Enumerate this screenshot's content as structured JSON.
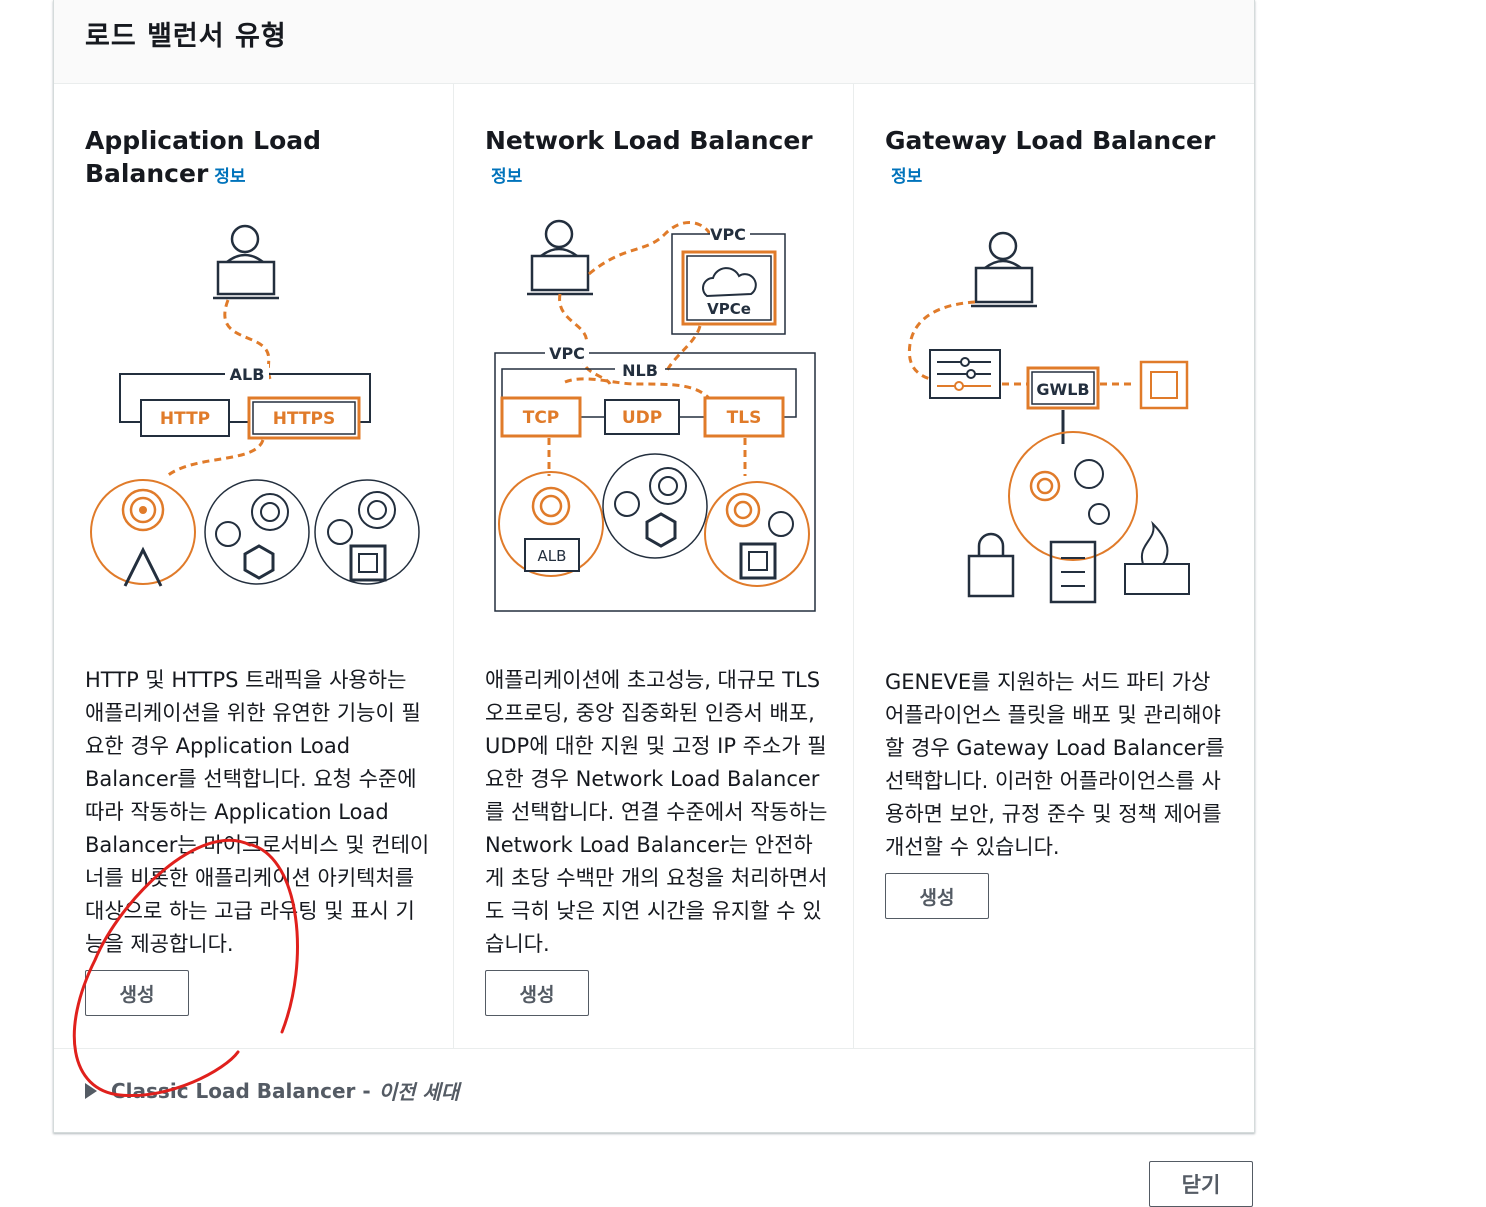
{
  "panel": {
    "title": "로드 밸런서 유형"
  },
  "cards": [
    {
      "title": "Application Load Balancer",
      "info": "정보",
      "diagram": {
        "group_label": "ALB",
        "listeners": [
          "HTTP",
          "HTTPS"
        ]
      },
      "description": "HTTP 및 HTTPS 트래픽을 사용하는 애플리케이션을 위한 유연한 기능이 필요한 경우 Application Load Balancer를 선택합니다. 요청 수준에 따라 작동하는 Application Load Balancer는 마이크로서비스 및 컨테이너를 비롯한 애플리케이션 아키텍처를 대상으로 하는 고급 라우팅 및 표시 기능을 제공합니다.",
      "create": "생성"
    },
    {
      "title": "Network Load Balancer",
      "info": "정보",
      "diagram": {
        "vpc": "VPC",
        "vpce": "VPCe",
        "nlb": "NLB",
        "listeners": [
          "TCP",
          "UDP",
          "TLS"
        ],
        "target": "ALB"
      },
      "description": "애플리케이션에 초고성능, 대규모 TLS 오프로딩, 중앙 집중화된 인증서 배포, UDP에 대한 지원 및 고정 IP 주소가 필요한 경우 Network Load Balancer를 선택합니다. 연결 수준에서 작동하는 Network Load Balancer는 안전하게 초당 수백만 개의 요청을 처리하면서도 극히 낮은 지연 시간을 유지할 수 있습니다.",
      "create": "생성"
    },
    {
      "title": "Gateway Load Balancer",
      "info": "정보",
      "diagram": {
        "gwlb": "GWLB"
      },
      "description": "GENEVE를 지원하는 서드 파티 가상 어플라이언스 플릿을 배포 및 관리해야 할 경우 Gateway Load Balancer를 선택합니다. 이러한 어플라이언스를 사용하면 보안, 규정 준수 및 정책 제어를 개선할 수 있습니다.",
      "create": "생성"
    }
  ],
  "classic": {
    "label": "Classic Load Balancer -",
    "era": "이전 세대"
  },
  "footer": {
    "close": "닫기"
  },
  "colors": {
    "accent": "#e07b2a",
    "link": "#0073bb",
    "annotation": "#e0201c"
  }
}
